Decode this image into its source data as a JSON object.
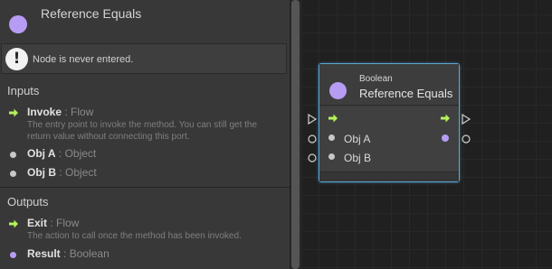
{
  "inspector": {
    "title": "Reference Equals",
    "warning": "Node is never entered.",
    "inputs_title": "Inputs",
    "outputs_title": "Outputs",
    "inputs": [
      {
        "name": "Invoke",
        "sep": " : ",
        "type": "Flow",
        "kind": "flow",
        "description": "The entry point to invoke the method. You can still get the return value without connecting this port."
      },
      {
        "name": "Obj A",
        "sep": " : ",
        "type": "Object",
        "kind": "value"
      },
      {
        "name": "Obj B",
        "sep": " : ",
        "type": "Object",
        "kind": "value"
      }
    ],
    "outputs": [
      {
        "name": "Exit",
        "sep": " : ",
        "type": "Flow",
        "kind": "flow",
        "description": "The action to call once the method has been invoked."
      },
      {
        "name": "Result",
        "sep": " : ",
        "type": "Boolean",
        "kind": "boolean"
      }
    ]
  },
  "node": {
    "subtitle": "Boolean",
    "title": "Reference Equals",
    "ports": {
      "obj_a": "Obj A",
      "obj_b": "Obj B"
    }
  },
  "colors": {
    "flow_arrow": "#b6f25a",
    "boolean_port": "#b79cf4",
    "object_port": "#c8c8c8",
    "selection": "#5aa7d6"
  },
  "icons": {
    "warning": "exclamation-icon",
    "flow": "flow-arrow-icon",
    "value": "dot-icon"
  }
}
